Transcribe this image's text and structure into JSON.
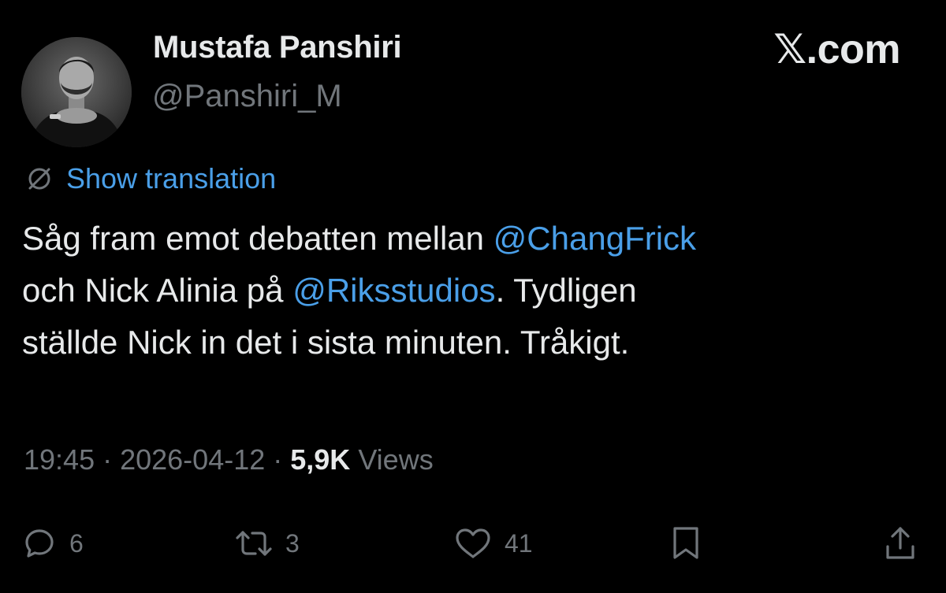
{
  "author": {
    "display_name": "Mustafa Panshiri",
    "handle": "@Panshiri_M"
  },
  "site": {
    "label": "𝕏.com"
  },
  "translation": {
    "label": "Show translation",
    "icon": "globe-slash-icon"
  },
  "tweet": {
    "lines": [
      [
        {
          "text": "Såg fram emot debatten mellan ",
          "type": "text"
        },
        {
          "text": "@ChangFrick",
          "type": "mention"
        }
      ],
      [
        {
          "text": "och Nick Alinia på ",
          "type": "text"
        },
        {
          "text": "@Riksstudios",
          "type": "mention"
        },
        {
          "text": ". Tydligen",
          "type": "text"
        }
      ],
      [
        {
          "text": "ställde Nick in det i sista minuten. Tråkigt.",
          "type": "text"
        }
      ]
    ]
  },
  "meta": {
    "time": "19:45",
    "separator": " · ",
    "date": "2026-04-12",
    "views_count": "5,9K",
    "views_label": "Views"
  },
  "actions": {
    "reply": {
      "icon": "reply-icon",
      "count": "6"
    },
    "repost": {
      "icon": "repost-icon",
      "count": "3"
    },
    "like": {
      "icon": "heart-icon",
      "count": "41"
    },
    "bookmark": {
      "icon": "bookmark-icon"
    },
    "share": {
      "icon": "share-icon"
    }
  },
  "colors": {
    "background": "#000000",
    "primary_text": "#e7e9ea",
    "secondary_text": "#71767b",
    "link": "#4a9fe8"
  }
}
